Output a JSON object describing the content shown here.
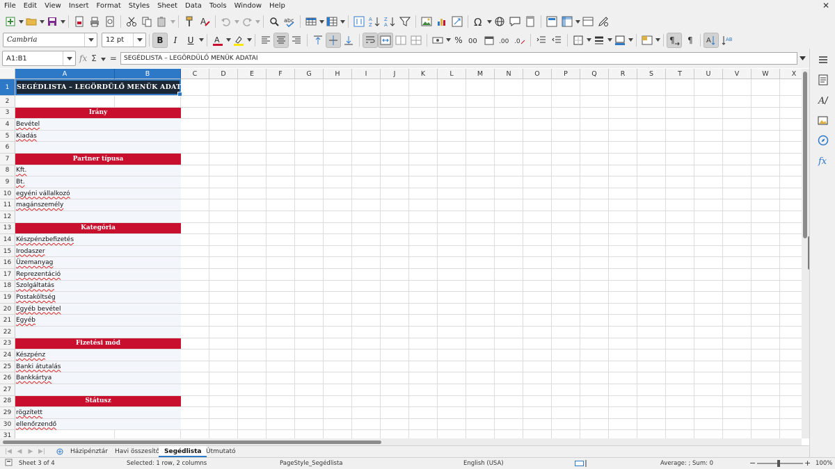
{
  "menubar": {
    "items": [
      "File",
      "Edit",
      "View",
      "Insert",
      "Format",
      "Styles",
      "Sheet",
      "Data",
      "Tools",
      "Window",
      "Help"
    ],
    "close_glyph": "✕"
  },
  "toolbar": {
    "font_name": "Cambria",
    "font_size": "12 pt",
    "bold_label": "B",
    "italic_label": "I",
    "underline_label": "U",
    "percent_label": "%",
    "decimal_label": "0.0",
    "accent_color": "#2e78c8",
    "font_color": "#c8102e",
    "highlight_color": "#ffe600"
  },
  "formula_bar": {
    "name_box": "A1:B1",
    "fx_label": "fx",
    "sum_label": "Σ",
    "equals_label": "=",
    "content": "SEGÉDLISTA – LEGÖRDÜLŐ MENÜK ADATAI"
  },
  "grid": {
    "columns": [
      "A",
      "B",
      "C",
      "D",
      "E",
      "F",
      "G",
      "H",
      "I",
      "J",
      "K",
      "L",
      "M",
      "N",
      "O",
      "P",
      "Q",
      "R",
      "S",
      "T",
      "U",
      "V",
      "W",
      "X"
    ],
    "rows": [
      "1",
      "2",
      "3",
      "4",
      "5",
      "6",
      "7",
      "8",
      "9",
      "10",
      "11",
      "12",
      "13",
      "14",
      "15",
      "16",
      "17",
      "18",
      "19",
      "20",
      "21",
      "22",
      "23",
      "24",
      "25",
      "26",
      "27",
      "28",
      "29",
      "30",
      "31"
    ],
    "title": "SEGÉDLISTA – LEGÖRDÜLŐ MENÜK ADATAI",
    "title_bg": "#1c2836",
    "section_color": "#c8102e",
    "sections": [
      {
        "title": "Irány",
        "items": [
          "Bevétel",
          "Kiadás"
        ]
      },
      {
        "title": "Partner típusa",
        "items": [
          "Kft.",
          "Bt.",
          "egyéni vállalkozó",
          "magánszemély"
        ]
      },
      {
        "title": "Kategória",
        "items": [
          "Készpénzbefizetés",
          "Irodaszer",
          "Üzemanyag",
          "Reprezentáció",
          "Szolgáltatás",
          "Postaköltség",
          "Egyéb bevétel",
          "Egyéb"
        ]
      },
      {
        "title": "Fizetési mód",
        "items": [
          "Készpénz",
          "Banki átutalás",
          "Bankkártya"
        ]
      },
      {
        "title": "Státusz",
        "items": [
          "rögzített",
          "ellenőrzendő"
        ]
      }
    ]
  },
  "sheet_tabs": {
    "tabs": [
      "Házipénztár",
      "Havi összesítő",
      "Segédlista",
      "Útmutató"
    ],
    "active": "Segédlista",
    "add_glyph": "+"
  },
  "statusbar": {
    "sheet_info": "Sheet 3 of 4",
    "selection": "Selected: 1 row, 2 columns",
    "page_style": "PageStyle_Segédlista",
    "language": "English (USA)",
    "stats": "Average: ; Sum: 0",
    "zoom_minus": "−",
    "zoom_plus": "+",
    "zoom": "100%"
  }
}
